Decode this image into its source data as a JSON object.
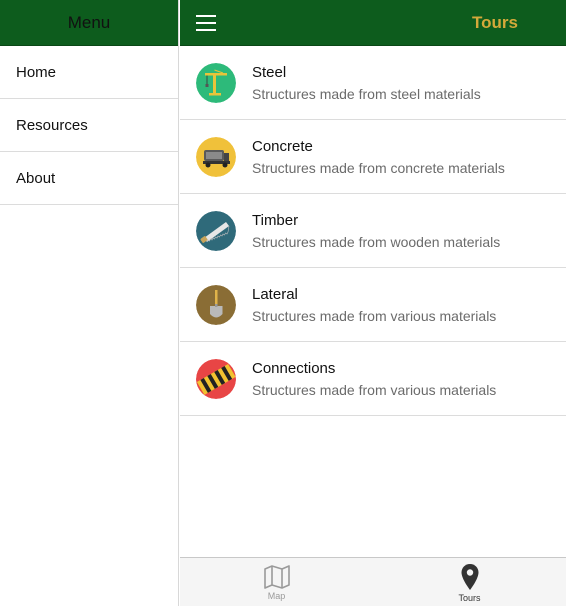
{
  "sidebar": {
    "title": "Menu",
    "items": [
      {
        "label": "Home"
      },
      {
        "label": "Resources"
      },
      {
        "label": "About"
      }
    ]
  },
  "header": {
    "title": "Tours",
    "menu_icon": "hamburger-icon"
  },
  "tours": [
    {
      "title": "Steel",
      "subtitle": "Structures made from steel materials",
      "icon": "crane-icon",
      "color": "#2dba7a"
    },
    {
      "title": "Concrete",
      "subtitle": "Structures made from concrete materials",
      "icon": "concrete-mixer-icon",
      "color": "#f0c13a"
    },
    {
      "title": "Timber",
      "subtitle": "Structures made from wooden materials",
      "icon": "saw-icon",
      "color": "#2f6a7a"
    },
    {
      "title": "Lateral",
      "subtitle": "Structures made from various materials",
      "icon": "shovel-icon",
      "color": "#8a6d35"
    },
    {
      "title": "Connections",
      "subtitle": "Structures made from various materials",
      "icon": "hazard-stripes-icon",
      "color": "#e84545"
    }
  ],
  "tabs": [
    {
      "label": "Map",
      "icon": "map-icon",
      "active": false
    },
    {
      "label": "Tours",
      "icon": "location-pin-icon",
      "active": true
    }
  ],
  "colors": {
    "header_green": "#0d5c1d",
    "title_gold": "#d4a93a"
  }
}
